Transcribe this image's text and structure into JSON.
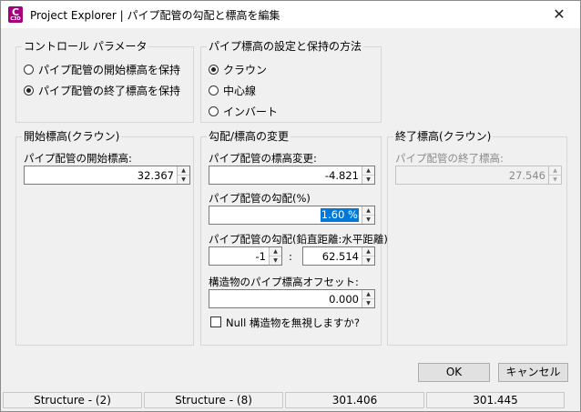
{
  "window": {
    "app_icon_letter": "C",
    "app_icon_sub": "C3D",
    "title": "Project Explorer | パイプ配管の勾配と標高を編集",
    "close_glyph": "✕"
  },
  "control_params": {
    "title": "コントロール パラメータ",
    "options": [
      {
        "label": "パイプ配管の開始標高を保持",
        "selected": false
      },
      {
        "label": "パイプ配管の終了標高を保持",
        "selected": true
      }
    ]
  },
  "invert_method": {
    "title": "パイプ標高の設定と保持の方法",
    "options": [
      {
        "label": "クラウン",
        "selected": true
      },
      {
        "label": "中心線",
        "selected": false
      },
      {
        "label": "インバート",
        "selected": false
      }
    ]
  },
  "start_elev": {
    "title": "開始標高(クラウン)",
    "label": "パイプ配管の開始標高:",
    "value": "32.367"
  },
  "slope_change": {
    "title": "勾配/標高の変更",
    "elev_change_label": "パイプ配管の標高変更:",
    "elev_change_value": "-4.821",
    "slope_label": "パイプ配管の勾配(%)",
    "slope_value": "1.60 %",
    "ratio_label": "パイプ配管の勾配(鉛直距離:水平距離)",
    "ratio_vertical": "-1",
    "ratio_sep": ":",
    "ratio_horizontal": "62.514",
    "offset_label": "構造物のパイプ標高オフセット:",
    "offset_value": "0.000",
    "ignore_null_label": "Null 構造物を無視しますか?",
    "ignore_null_checked": false
  },
  "end_elev": {
    "title": "終了標高(クラウン)",
    "label": "パイプ配管の終了標高:",
    "value": "27.546"
  },
  "buttons": {
    "ok": "OK",
    "cancel": "キャンセル"
  },
  "status_bar": [
    "Structure - (2)",
    "Structure - (8)",
    "301.406",
    "301.445"
  ],
  "arrow_up_glyph": "▲",
  "arrow_down_glyph": "▼",
  "colors": {
    "selection": "#0078d7",
    "app_icon": "#a2007d"
  }
}
